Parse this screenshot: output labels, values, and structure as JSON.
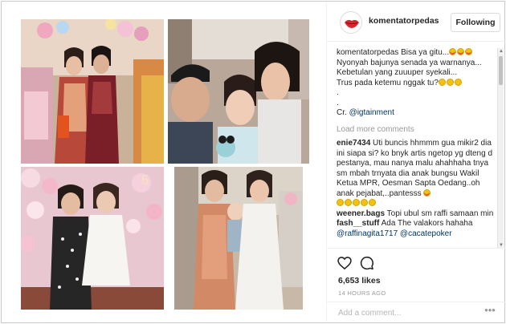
{
  "post": {
    "username": "komentatorpedas",
    "follow_label": "Following",
    "caption": {
      "user": "komentatorpedas",
      "line1": "Bisa ya gitu...",
      "line2": "Nyonyah bajunya senada ya warnanya...",
      "line3": "Kebetulan yang zuuuper syekali...",
      "line4": "Trus pada ketemu nggak tu?",
      "dot1": ".",
      "dot2": ".",
      "credit_prefix": "Cr. ",
      "credit_mention": "@igtainment"
    },
    "load_more_label": "Load more comments",
    "comments": [
      {
        "user": "enie7434",
        "text": "Uti buncis hhmmm gua mikir2 dia ini siapa si? ko bnyk artis ngetop yg dteng d pestanya, mau nanya malu ahahhaha tnya sm mbah trnyata dia anak bungsu Wakil Ketua MPR, Oesman Sapta Oedang..oh anak pejabat,..pantesss"
      },
      {
        "user": "weener.bags",
        "text": "Topi ubul sm raffi samaan min"
      },
      {
        "user": "fash__stuff",
        "text": "Ada The valakors hahaha",
        "mentions": "@raffinagita1717 @cacatepoker"
      }
    ],
    "likes": "6,653 likes",
    "timestamp": "14 HOURS AGO",
    "add_comment_placeholder": "Add a comment...",
    "more_options_label": "•••"
  },
  "colors": {
    "accent_link": "#003569",
    "muted": "#999999",
    "border": "#efefef",
    "brand_red": "#d9262c"
  },
  "icons": {
    "avatar": "red-lips-logo",
    "like": "heart-outline-icon",
    "comment": "speech-bubble-icon"
  }
}
